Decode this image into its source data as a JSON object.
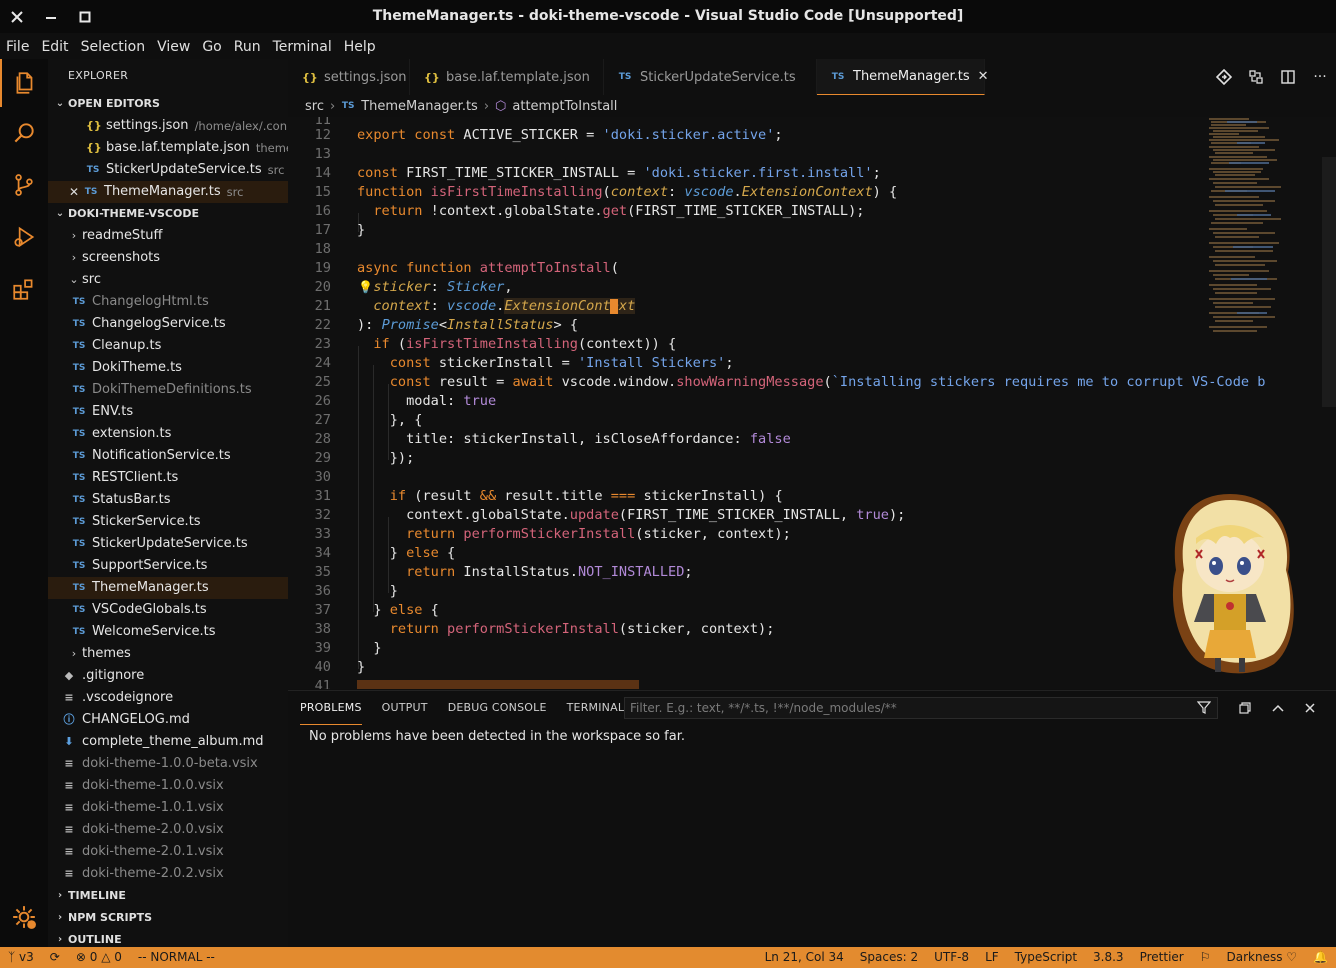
{
  "window": {
    "title": "ThemeManager.ts - doki-theme-vscode - Visual Studio Code [Unsupported]"
  },
  "menu": [
    "File",
    "Edit",
    "Selection",
    "View",
    "Go",
    "Run",
    "Terminal",
    "Help"
  ],
  "sidebar": {
    "title": "EXPLORER",
    "open_editors_label": "OPEN EDITORS",
    "open_editors": [
      {
        "name": "settings.json",
        "hint": "/home/alex/.con...",
        "icon": "json"
      },
      {
        "name": "base.laf.template.json",
        "hint": "theme...",
        "icon": "json"
      },
      {
        "name": "StickerUpdateService.ts",
        "hint": "src",
        "icon": "ts"
      },
      {
        "name": "ThemeManager.ts",
        "hint": "src",
        "icon": "ts"
      }
    ],
    "project_label": "DOKI-THEME-VSCODE",
    "folders": [
      "readmeStuff",
      "screenshots",
      "src"
    ],
    "src_files": [
      "ChangelogHtml.ts",
      "ChangelogService.ts",
      "Cleanup.ts",
      "DokiTheme.ts",
      "DokiThemeDefinitions.ts",
      "ENV.ts",
      "extension.ts",
      "NotificationService.ts",
      "RESTClient.ts",
      "StatusBar.ts",
      "StickerService.ts",
      "StickerUpdateService.ts",
      "SupportService.ts",
      "ThemeManager.ts",
      "VSCodeGlobals.ts",
      "WelcomeService.ts"
    ],
    "root_items": [
      "themes",
      ".gitignore",
      ".vscodeignore",
      "CHANGELOG.md",
      "complete_theme_album.md",
      "doki-theme-1.0.0-beta.vsix",
      "doki-theme-1.0.0.vsix",
      "doki-theme-1.0.1.vsix",
      "doki-theme-2.0.0.vsix",
      "doki-theme-2.0.1.vsix",
      "doki-theme-2.0.2.vsix"
    ],
    "timeline_label": "TIMELINE",
    "npm_label": "NPM SCRIPTS",
    "outline_label": "OUTLINE"
  },
  "tabs": [
    {
      "label": "settings.json",
      "icon": "json"
    },
    {
      "label": "base.laf.template.json",
      "icon": "json"
    },
    {
      "label": "StickerUpdateService.ts",
      "icon": "ts"
    },
    {
      "label": "ThemeManager.ts",
      "icon": "ts",
      "active": true
    }
  ],
  "breadcrumb": {
    "folder": "src",
    "file": "ThemeManager.ts",
    "symbol": "attemptToInstall"
  },
  "panel": {
    "tabs": [
      "PROBLEMS",
      "OUTPUT",
      "DEBUG CONSOLE",
      "TERMINAL"
    ],
    "filter_placeholder": "Filter. E.g.: text, **/*.ts, !**/node_modules/**",
    "message": "No problems have been detected in the workspace so far."
  },
  "status": {
    "branch": "v3",
    "problems": "0",
    "warnings": "0",
    "mode": "-- NORMAL --",
    "position": "Ln 21, Col 34",
    "spaces": "Spaces: 2",
    "encoding": "UTF-8",
    "eol": "LF",
    "language": "TypeScript",
    "ts_version": "3.8.3",
    "formatter": "Prettier",
    "theme": "Darkness"
  },
  "colors": {
    "accent": "#e38b2f",
    "keyword": "#e8892e",
    "string": "#74a4ea",
    "function": "#d4647a"
  }
}
